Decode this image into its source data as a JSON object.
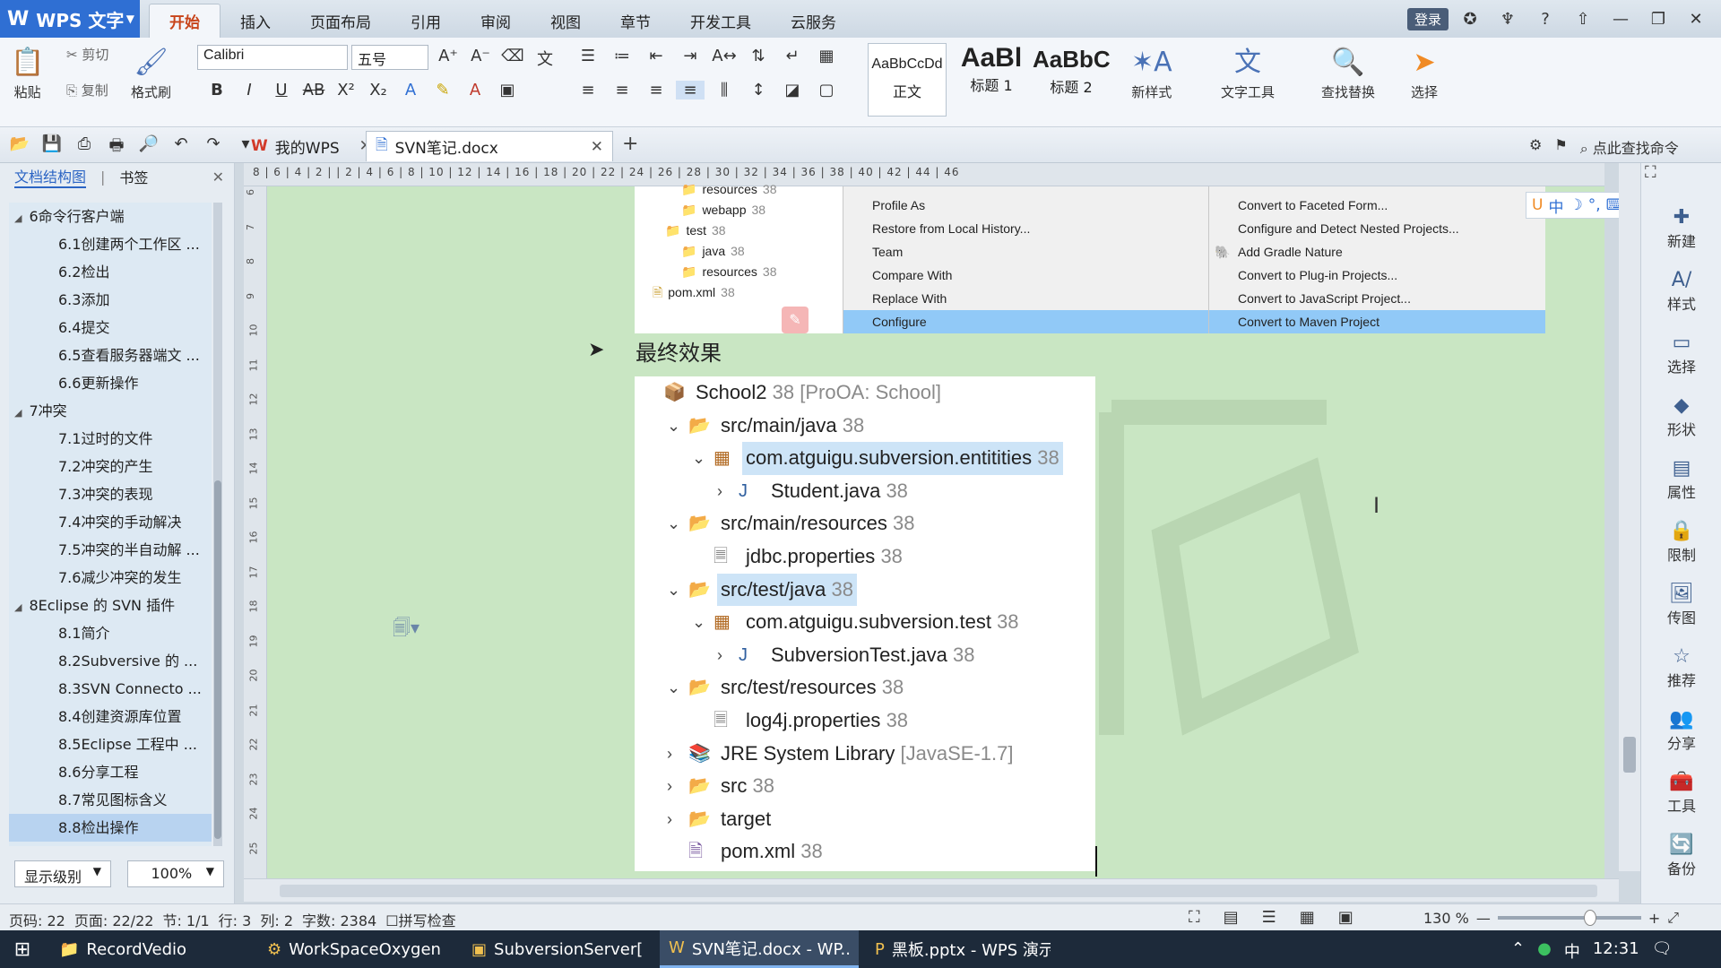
{
  "app": {
    "name": "WPS 文字"
  },
  "ribbon_tabs": [
    "开始",
    "插入",
    "页面布局",
    "引用",
    "审阅",
    "视图",
    "章节",
    "开发工具",
    "云服务"
  ],
  "ribbon": {
    "paste": "粘贴",
    "cut": "剪切",
    "copy": "复制",
    "format_painter": "格式刷",
    "font_name": "Calibri",
    "font_size": "五号",
    "styles": [
      {
        "preview": "AaBbCcDd",
        "name": "正文"
      },
      {
        "preview": "AaBl",
        "name": "标题 1"
      },
      {
        "preview": "AaBbC",
        "name": "标题 2"
      }
    ],
    "new_style": "新样式",
    "text_tools": "文字工具",
    "find_replace": "查找替换",
    "select": "选择"
  },
  "doc_tabs": [
    {
      "label": "我的WPS"
    },
    {
      "label": "SVN笔记.docx"
    }
  ],
  "search_command": "点此查找命令",
  "nav": {
    "tab_outline": "文档结构图",
    "tab_bookmark": "书签",
    "items": [
      {
        "label": "6命令行客户端",
        "level": 1
      },
      {
        "label": "6.1创建两个工作区 ...",
        "level": 2
      },
      {
        "label": "6.2检出",
        "level": 2
      },
      {
        "label": "6.3添加",
        "level": 2
      },
      {
        "label": "6.4提交",
        "level": 2
      },
      {
        "label": "6.5查看服务器端文 ...",
        "level": 2
      },
      {
        "label": "6.6更新操作",
        "level": 2
      },
      {
        "label": "7冲突",
        "level": 1
      },
      {
        "label": "7.1过时的文件",
        "level": 2
      },
      {
        "label": "7.2冲突的产生",
        "level": 2
      },
      {
        "label": "7.3冲突的表现",
        "level": 2
      },
      {
        "label": "7.4冲突的手动解决",
        "level": 2
      },
      {
        "label": "7.5冲突的半自动解 ...",
        "level": 2
      },
      {
        "label": "7.6减少冲突的发生",
        "level": 2
      },
      {
        "label": "8Eclipse 的 SVN 插件",
        "level": 1
      },
      {
        "label": "8.1简介",
        "level": 2
      },
      {
        "label": "8.2Subversive 的 ...",
        "level": 2
      },
      {
        "label": "8.3SVN Connecto ...",
        "level": 2
      },
      {
        "label": "8.4创建资源库位置",
        "level": 2
      },
      {
        "label": "8.5Eclipse 工程中 ...",
        "level": 2
      },
      {
        "label": "8.6分享工程",
        "level": 2
      },
      {
        "label": "8.7常见图标含义",
        "level": 2
      },
      {
        "label": "8.8检出操作",
        "level": 2
      }
    ],
    "level_select": "显示级别",
    "zoom_select": "100%"
  },
  "ruler_text": "8 | 6 | 4 | 2 | | 2 | 4 | 6 | 8 | 10 | 12 | 14 | 16 | 18 | 20 | 22 | 24 | 26 | 28 | 30 | 32 | 34 | 36 | 38 | 40 | 42 | 44 | 46",
  "vruler_numbers": [
    "6",
    "7",
    "8",
    "9",
    "10",
    "11",
    "12",
    "13",
    "14",
    "15",
    "16",
    "17",
    "18",
    "19",
    "20",
    "21",
    "22",
    "23",
    "24",
    "25"
  ],
  "top_image": {
    "tree": [
      {
        "name": "resources",
        "count": "38",
        "indent": 1
      },
      {
        "name": "webapp",
        "count": "38",
        "indent": 1
      },
      {
        "name": "test",
        "count": "38",
        "indent": 0
      },
      {
        "name": "java",
        "count": "38",
        "indent": 1
      },
      {
        "name": "resources",
        "count": "38",
        "indent": 1
      },
      {
        "name": "pom.xml",
        "count": "38",
        "indent": -1
      }
    ],
    "menu1": [
      {
        "label": "Profile As",
        "arrow": true
      },
      {
        "label": "Restore from Local History...",
        "arrow": false
      },
      {
        "label": "Team",
        "arrow": true
      },
      {
        "label": "Compare With",
        "arrow": true
      },
      {
        "label": "Replace With",
        "arrow": true
      },
      {
        "label": "Configure",
        "arrow": true,
        "highlight": true
      }
    ],
    "menu2": [
      {
        "label": "Convert to Faceted Form..."
      },
      {
        "label": "Configure and Detect Nested Projects..."
      },
      {
        "label": "Add Gradle Nature"
      },
      {
        "label": "Convert to Plug-in Projects..."
      },
      {
        "label": "Convert to JavaScript Project..."
      },
      {
        "label": "Convert to Maven Project",
        "highlight": true
      }
    ]
  },
  "heading": "最终效果",
  "main_tree": [
    {
      "label": "School2",
      "suffix": "38 [ProOA: School]",
      "indent": 0,
      "chev": "",
      "icon": "project"
    },
    {
      "label": "src/main/java",
      "suffix": "38",
      "indent": 1,
      "chev": "v",
      "icon": "folder"
    },
    {
      "label": "com.atguigu.subversion.entitities",
      "suffix": "38",
      "indent": 2,
      "chev": "v",
      "icon": "package",
      "selected": true
    },
    {
      "label": "Student.java",
      "suffix": "38",
      "indent": 3,
      "chev": ">",
      "icon": "java"
    },
    {
      "label": "src/main/resources",
      "suffix": "38",
      "indent": 1,
      "chev": "v",
      "icon": "folder"
    },
    {
      "label": "jdbc.properties",
      "suffix": "38",
      "indent": 2,
      "chev": "",
      "icon": "file"
    },
    {
      "label": "src/test/java",
      "suffix": "38",
      "indent": 1,
      "chev": "v",
      "icon": "folder",
      "selected": true
    },
    {
      "label": "com.atguigu.subversion.test",
      "suffix": "38",
      "indent": 2,
      "chev": "v",
      "icon": "package"
    },
    {
      "label": "SubversionTest.java",
      "suffix": "38",
      "indent": 3,
      "chev": ">",
      "icon": "java"
    },
    {
      "label": "src/test/resources",
      "suffix": "38",
      "indent": 1,
      "chev": "v",
      "icon": "folder"
    },
    {
      "label": "log4j.properties",
      "suffix": "38",
      "indent": 2,
      "chev": "",
      "icon": "file"
    },
    {
      "label": "JRE System Library",
      "suffix": "[JavaSE-1.7]",
      "indent": 1,
      "chev": ">",
      "icon": "library"
    },
    {
      "label": "src",
      "suffix": "38",
      "indent": 1,
      "chev": ">",
      "icon": "folder"
    },
    {
      "label": "target",
      "suffix": "",
      "indent": 1,
      "chev": ">",
      "icon": "folder"
    },
    {
      "label": "pom.xml",
      "suffix": "38",
      "indent": 1,
      "chev": "",
      "icon": "xml"
    }
  ],
  "right_sidebar": [
    "新建",
    "样式",
    "选择",
    "形状",
    "属性",
    "限制",
    "传图",
    "推荐",
    "分享",
    "工具",
    "备份"
  ],
  "status": {
    "page_num": "页码: 22",
    "pages": "页面: 22/22",
    "section": "节: 1/1",
    "row": "行: 3",
    "col": "列: 2",
    "words": "字数: 2384",
    "spell": "拼写检查",
    "zoom": "130 %"
  },
  "taskbar": [
    {
      "label": "RecordVedio",
      "icon": "folder-icon",
      "active": false
    },
    {
      "label": "WorkSpaceOxygen ...",
      "icon": "eclipse-icon",
      "active": false
    },
    {
      "label": "SubversionServer[1...",
      "icon": "terminal-icon",
      "active": false
    },
    {
      "label": "SVN笔记.docx - WP...",
      "icon": "wps-writer-icon",
      "active": true
    },
    {
      "label": "黑板.pptx - WPS 演示",
      "icon": "wps-present-icon",
      "active": false
    }
  ],
  "clock": "12:31",
  "ime_lang": "中",
  "user_label": "登录",
  "colors": {
    "accent": "#2f6fd3",
    "doc_bg": "#c9e6c3",
    "menu_highlight": "#91c9f7",
    "active_tab": "#c8441a"
  }
}
